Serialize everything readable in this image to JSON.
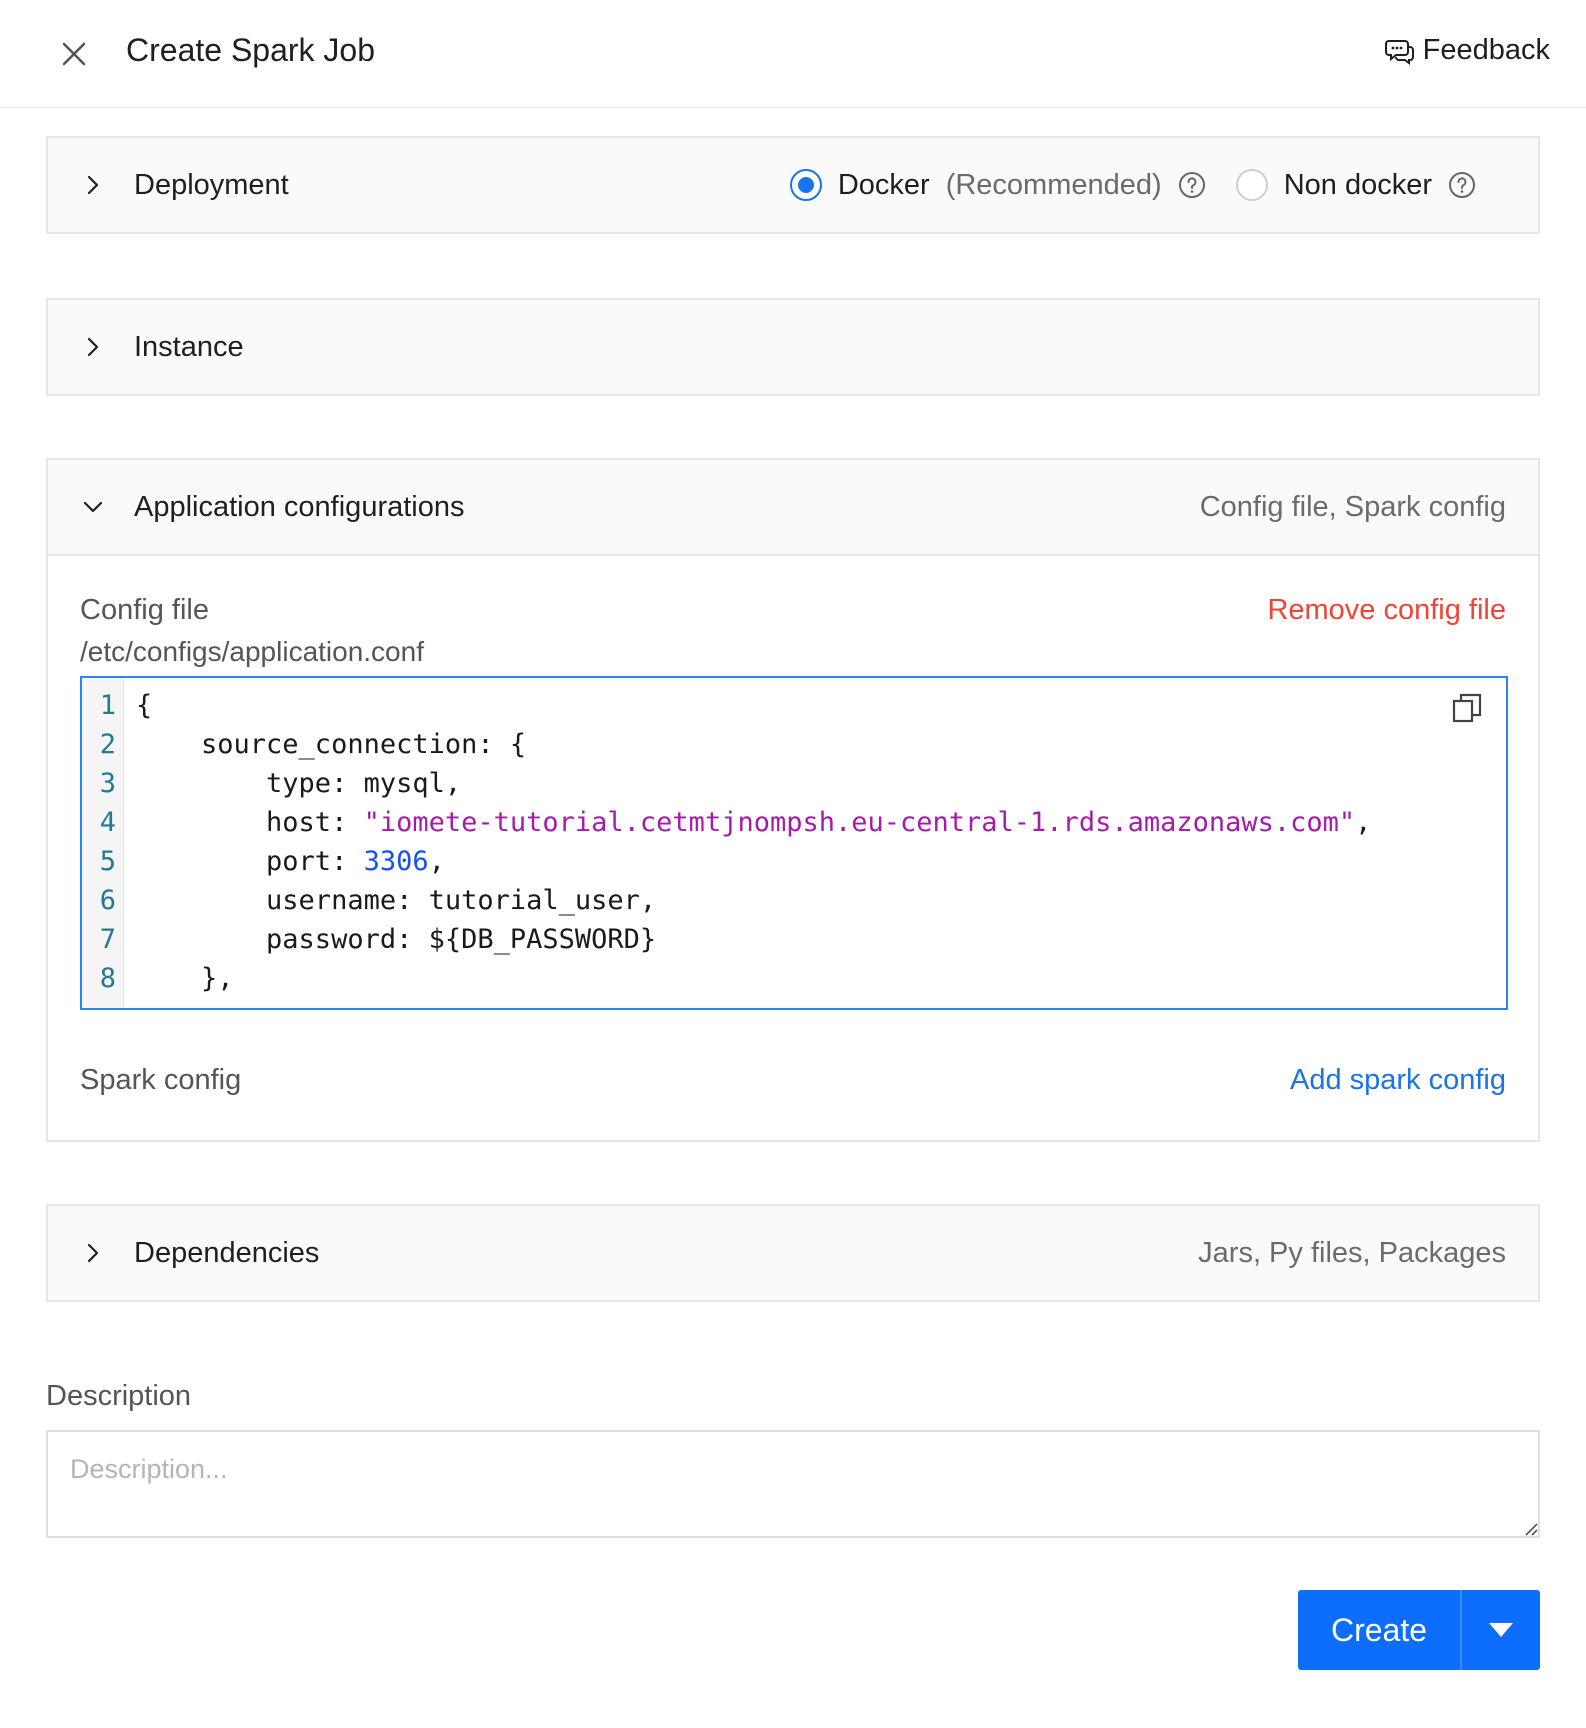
{
  "header": {
    "title": "Create Spark Job",
    "feedback_label": "Feedback",
    "close_icon": "close-icon"
  },
  "deployment": {
    "title": "Deployment",
    "options": [
      {
        "label": "Docker",
        "note": "(Recommended)",
        "selected": true
      },
      {
        "label": "Non docker",
        "selected": false
      }
    ]
  },
  "instance": {
    "title": "Instance"
  },
  "app_config": {
    "title": "Application configurations",
    "subtitle": "Config file, Spark config",
    "config_file_label": "Config file",
    "remove_label": "Remove config file",
    "config_path": "/etc/configs/application.conf",
    "line_numbers": [
      "1",
      "2",
      "3",
      "4",
      "5",
      "6",
      "7",
      "8"
    ],
    "code": {
      "l1": "{",
      "l2": "    source_connection: {",
      "l3": "        type: mysql,",
      "l4_key": "        host: ",
      "l4_str": "\"iomete-tutorial.cetmtjnompsh.eu-central-1.rds.amazonaws.com\"",
      "l4_end": ",",
      "l5_key": "        port: ",
      "l5_num": "3306",
      "l5_end": ",",
      "l6": "        username: tutorial_user,",
      "l7": "        password: ${DB_PASSWORD}",
      "l8": "    },"
    },
    "spark_config_label": "Spark config",
    "add_spark_label": "Add spark config"
  },
  "dependencies": {
    "title": "Dependencies",
    "subtitle": "Jars, Py files, Packages"
  },
  "description": {
    "label": "Description",
    "placeholder": "Description...",
    "value": ""
  },
  "actions": {
    "create_label": "Create"
  },
  "colors": {
    "accent": "#1a73e8",
    "primary_button": "#0d6efd",
    "danger": "#f04438",
    "code_string": "#a31caa",
    "code_number": "#1750eb"
  }
}
